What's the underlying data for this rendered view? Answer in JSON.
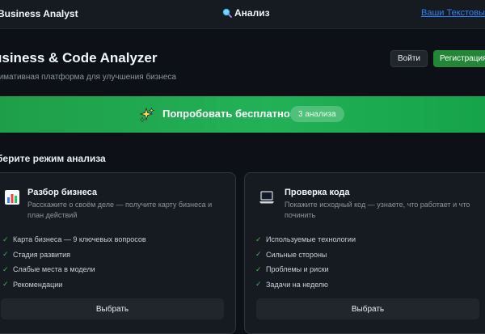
{
  "header": {
    "brand": "Business Analyst",
    "center_title": "Анализ",
    "center_icon": "search-icon",
    "link_label": "Ваши Текстовые..."
  },
  "hero": {
    "title": "usiness & Code Analyzer",
    "subtitle": "тимативная платформа для улучшения бизнеса",
    "login_label": "Войти",
    "register_label": "Регистрация"
  },
  "banner": {
    "icon": "sparkles-icon",
    "text": "Попробовать бесплатно",
    "badge": "3 анализа"
  },
  "section": {
    "title": "берите режим анализа"
  },
  "cards": [
    {
      "icon": "bar-chart-icon",
      "title": "Разбор бизнеса",
      "description": "Расскажите о своём деле — получите карту бизнеса и план действий",
      "features": [
        "Карта бизнеса — 9 ключевых вопросов",
        "Стадия развития",
        "Слабые места в модели",
        "Рекомендации"
      ],
      "button_label": "Выбрать"
    },
    {
      "icon": "laptop-icon",
      "title": "Проверка кода",
      "description": "Покажите исходный код — узнаете, что работает и что починить",
      "features": [
        "Используемые технологии",
        "Сильные стороны",
        "Проблемы и риски",
        "Задачи на неделю"
      ],
      "button_label": "Выбрать"
    }
  ],
  "colors": {
    "background": "#0d1117",
    "surface": "#161b22",
    "accent_green": "#238636",
    "banner_green": "#22b157",
    "check_green": "#3fb950",
    "link_blue": "#2f81f7"
  }
}
